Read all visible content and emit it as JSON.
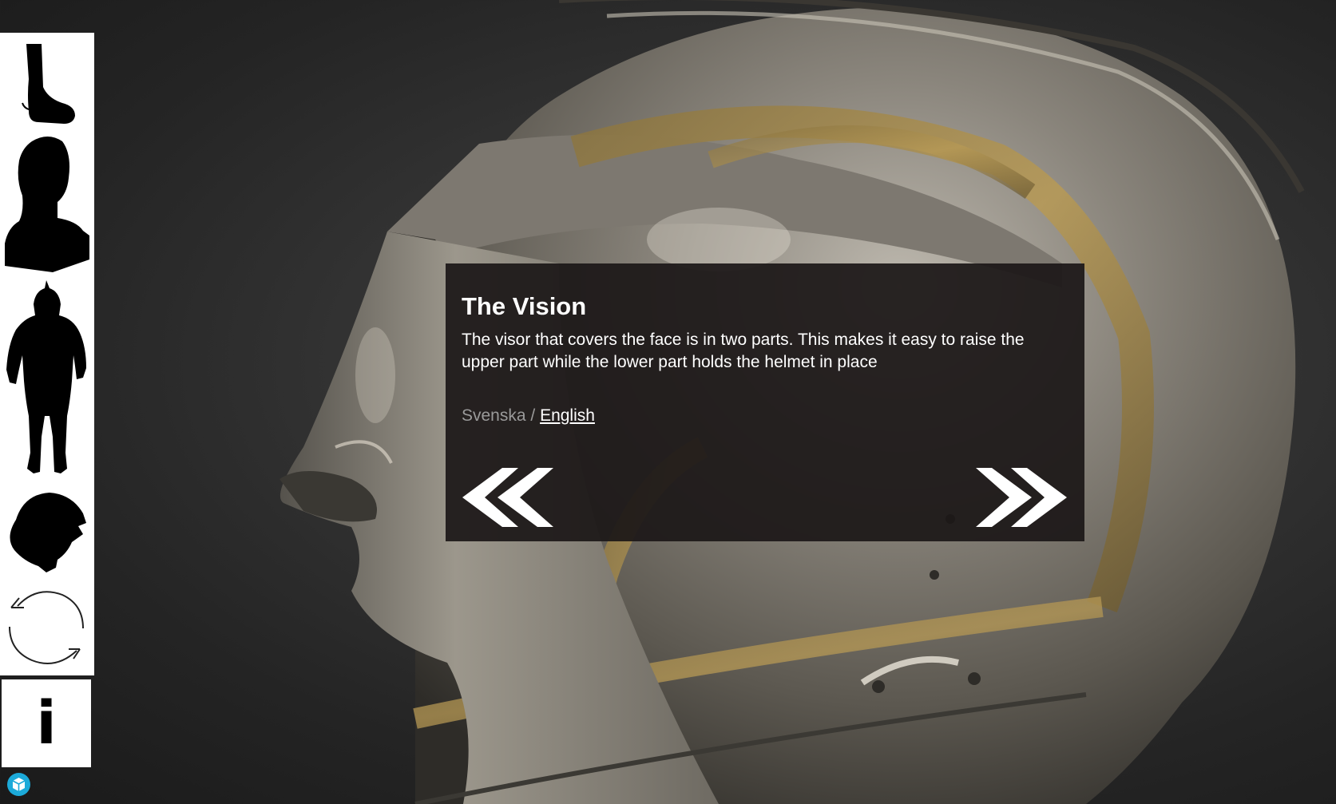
{
  "annotation": {
    "title": "The Vision",
    "text": "The visor that covers the face is in two parts. This makes it easy to raise the upper part while the lower part holds the helmet in place",
    "languages": {
      "svenska": "Svenska",
      "separator": " / ",
      "english": "English",
      "selected": "English"
    },
    "prev_icon": "double-chevron-left-icon",
    "next_icon": "double-chevron-right-icon"
  },
  "sidebar": {
    "items": [
      {
        "icon": "boot-icon"
      },
      {
        "icon": "bust-icon"
      },
      {
        "icon": "full-armor-icon"
      },
      {
        "icon": "helmet-icon"
      },
      {
        "icon": "rotate-icon"
      }
    ],
    "info_label": "i"
  },
  "colors": {
    "panel_bg": "#1c1818",
    "sidebar_bg": "#ffffff",
    "logo_blue": "#1caad9",
    "muted_text": "#9a9a9a"
  }
}
